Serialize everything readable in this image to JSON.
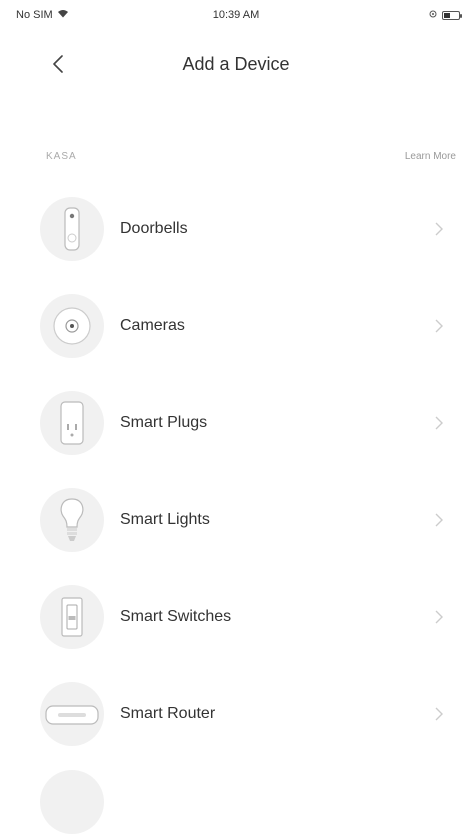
{
  "status_bar": {
    "carrier": "No SIM",
    "time": "10:39 AM"
  },
  "header": {
    "title": "Add a Device"
  },
  "section": {
    "label": "KASA",
    "learn_more": "Learn More"
  },
  "devices": [
    {
      "label": "Doorbells",
      "icon": "doorbell-icon"
    },
    {
      "label": "Cameras",
      "icon": "camera-icon"
    },
    {
      "label": "Smart Plugs",
      "icon": "smart-plug-icon"
    },
    {
      "label": "Smart Lights",
      "icon": "light-bulb-icon"
    },
    {
      "label": "Smart Switches",
      "icon": "light-switch-icon"
    },
    {
      "label": "Smart Router",
      "icon": "router-icon"
    }
  ],
  "colors": {
    "background": "#ffffff",
    "icon_circle": "#f1f1f1",
    "text": "#333333",
    "muted": "#aaaaaa"
  }
}
